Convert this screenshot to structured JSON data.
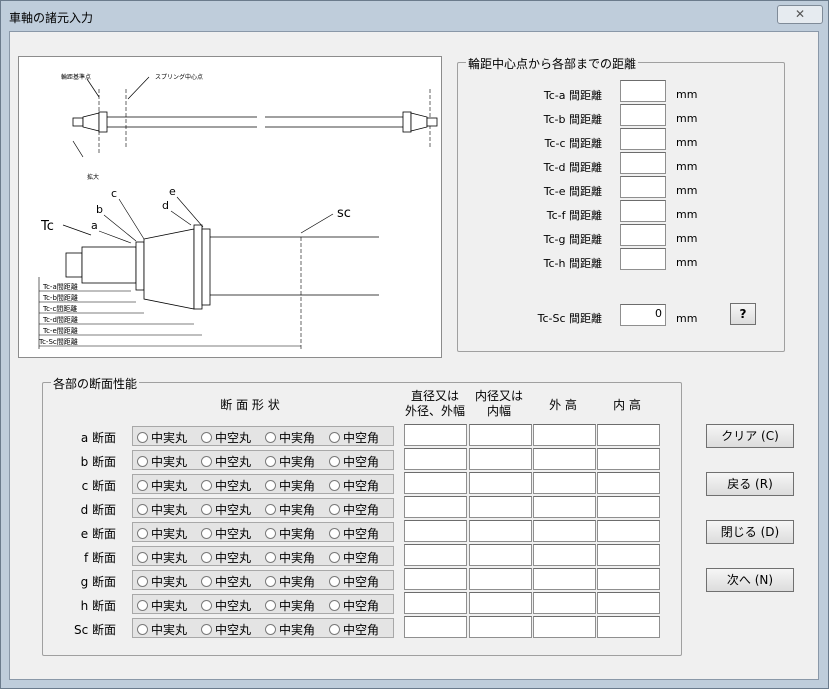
{
  "window": {
    "title": "車軸の諸元入力",
    "close_symbol": "✕"
  },
  "distance_group": {
    "title": "輪距中心点から各部までの距離",
    "rows": [
      {
        "label": "Tc-a 間距離",
        "value": "",
        "unit": "mm"
      },
      {
        "label": "Tc-b 間距離",
        "value": "",
        "unit": "mm"
      },
      {
        "label": "Tc-c 間距離",
        "value": "",
        "unit": "mm"
      },
      {
        "label": "Tc-d 間距離",
        "value": "",
        "unit": "mm"
      },
      {
        "label": "Tc-e 間距離",
        "value": "",
        "unit": "mm"
      },
      {
        "label": "Tc-f 間距離",
        "value": "",
        "unit": "mm"
      },
      {
        "label": "Tc-g 間距離",
        "value": "",
        "unit": "mm"
      },
      {
        "label": "Tc-h 間距離",
        "value": "",
        "unit": "mm"
      }
    ],
    "sc": {
      "label": "Tc-Sc 間距離",
      "value": "0",
      "unit": "mm"
    },
    "help_label": "?"
  },
  "section_group": {
    "title": "各部の断面性能",
    "header_shape": "断 面 形 状",
    "header_col1_line1": "直径又は",
    "header_col1_line2": "外径、外幅",
    "header_col2_line1": "内径又は",
    "header_col2_line2": "内幅",
    "header_col3": "外 高",
    "header_col4": "内 高",
    "options": [
      "中実丸",
      "中空丸",
      "中実角",
      "中空角"
    ],
    "rows": [
      {
        "label": "a 断面"
      },
      {
        "label": "b 断面"
      },
      {
        "label": "c 断面"
      },
      {
        "label": "d 断面"
      },
      {
        "label": "e 断面"
      },
      {
        "label": "f 断面"
      },
      {
        "label": "g 断面"
      },
      {
        "label": "h 断面"
      },
      {
        "label": "Sc 断面"
      }
    ]
  },
  "buttons": {
    "clear": "クリア (C)",
    "back": "戻る (R)",
    "close": "閉じる (D)",
    "next": "次へ (N)"
  },
  "diagram": {
    "label_wheel_base": "輪距基準点",
    "label_spring": "スプリング中心点",
    "label_zoom": "拡大",
    "label_tc": "Tc",
    "label_sc": "sc",
    "letters": [
      "a",
      "b",
      "c",
      "d",
      "e"
    ],
    "dims": [
      "Tc-a間距離",
      "Tc-b間距離",
      "Tc-c間距離",
      "Tc-d間距離",
      "Tc-e間距離",
      "Tc-Sc間距離"
    ]
  }
}
